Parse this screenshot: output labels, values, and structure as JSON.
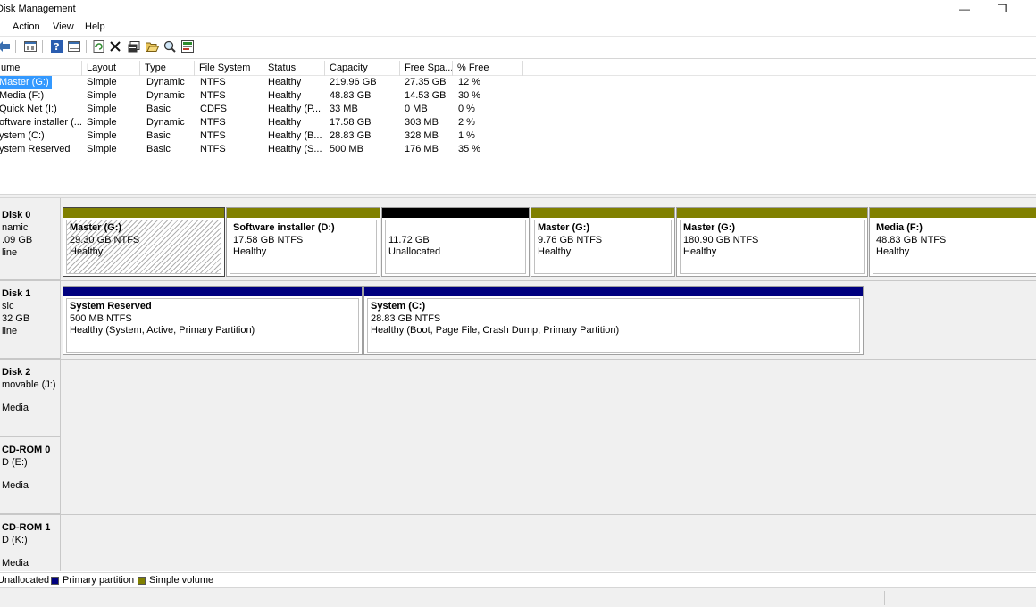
{
  "window": {
    "title": "Disk Management",
    "minimize_glyph": "—",
    "restore_glyph": "❐"
  },
  "menu": [
    "Action",
    "View",
    "Help"
  ],
  "toolbar": {
    "icons": [
      "back-icon",
      "forward-icon",
      "console-icon",
      "help-icon",
      "show-hide-icon",
      "refresh-icon",
      "delete-icon",
      "properties-icon",
      "open-icon",
      "explore-icon",
      "rescan-icon"
    ]
  },
  "volume_list": {
    "columns": [
      "ume",
      "Layout",
      "Type",
      "File System",
      "Status",
      "Capacity",
      "Free Spa...",
      "% Free"
    ],
    "rows": [
      {
        "volume": "Master (G:)",
        "layout": "Simple",
        "type": "Dynamic",
        "fs": "NTFS",
        "status": "Healthy",
        "capacity": "219.96 GB",
        "free": "27.35 GB",
        "pct": "12 %"
      },
      {
        "volume": "Media (F:)",
        "layout": "Simple",
        "type": "Dynamic",
        "fs": "NTFS",
        "status": "Healthy",
        "capacity": "48.83 GB",
        "free": "14.53 GB",
        "pct": "30 %"
      },
      {
        "volume": "Quick Net (I:)",
        "layout": "Simple",
        "type": "Basic",
        "fs": "CDFS",
        "status": "Healthy (P...",
        "capacity": "33 MB",
        "free": "0 MB",
        "pct": "0 %"
      },
      {
        "volume": "oftware installer (...",
        "layout": "Simple",
        "type": "Dynamic",
        "fs": "NTFS",
        "status": "Healthy",
        "capacity": "17.58 GB",
        "free": "303 MB",
        "pct": "2 %"
      },
      {
        "volume": "ystem (C:)",
        "layout": "Simple",
        "type": "Basic",
        "fs": "NTFS",
        "status": "Healthy (B...",
        "capacity": "28.83 GB",
        "free": "328 MB",
        "pct": "1 %"
      },
      {
        "volume": "ystem Reserved",
        "layout": "Simple",
        "type": "Basic",
        "fs": "NTFS",
        "status": "Healthy (S...",
        "capacity": "500 MB",
        "free": "176 MB",
        "pct": "35 %"
      }
    ],
    "selected_row": 0
  },
  "disks": [
    {
      "label_lines": [
        "Disk 0",
        "namic",
        ".09 GB",
        "line"
      ],
      "partitions": [
        {
          "name": "Master  (G:)",
          "size": "29.30 GB NTFS",
          "status": "Healthy",
          "bar_color": "#808000",
          "selected": true
        },
        {
          "name": "Software installer  (D:)",
          "size": "17.58 GB NTFS",
          "status": "Healthy",
          "bar_color": "#808000"
        },
        {
          "name": "",
          "size": "11.72 GB",
          "status": "Unallocated",
          "bar_color": "#000000"
        },
        {
          "name": "Master  (G:)",
          "size": "9.76 GB NTFS",
          "status": "Healthy",
          "bar_color": "#808000"
        },
        {
          "name": "Master  (G:)",
          "size": "180.90 GB NTFS",
          "status": "Healthy",
          "bar_color": "#808000"
        },
        {
          "name": "Media  (F:)",
          "size": "48.83 GB NTFS",
          "status": "Healthy",
          "bar_color": "#808000"
        }
      ]
    },
    {
      "label_lines": [
        "Disk 1",
        "sic",
        "32 GB",
        "line"
      ],
      "partitions": [
        {
          "name": "System Reserved",
          "size": "500 MB NTFS",
          "status": "Healthy (System, Active, Primary Partition)",
          "bar_color": "#00007f"
        },
        {
          "name": "System  (C:)",
          "size": "28.83 GB NTFS",
          "status": "Healthy (Boot, Page File, Crash Dump, Primary Partition)",
          "bar_color": "#00007f"
        }
      ]
    },
    {
      "label_lines": [
        "Disk 2",
        "movable (J:)",
        "",
        "Media"
      ],
      "partitions": []
    },
    {
      "label_lines": [
        "CD-ROM 0",
        "D (E:)",
        "",
        "Media"
      ],
      "partitions": []
    },
    {
      "label_lines": [
        "CD-ROM 1",
        "D (K:)",
        "",
        "Media"
      ],
      "partitions": []
    }
  ],
  "legend": [
    {
      "label": "Unallocated",
      "color": "#000000"
    },
    {
      "label": "Primary partition",
      "color": "#00007f"
    },
    {
      "label": "Simple volume",
      "color": "#808000"
    }
  ],
  "colors": {
    "simple_volume": "#808000",
    "primary_partition": "#00007f",
    "unallocated": "#000000",
    "selection": "#3399ff"
  }
}
